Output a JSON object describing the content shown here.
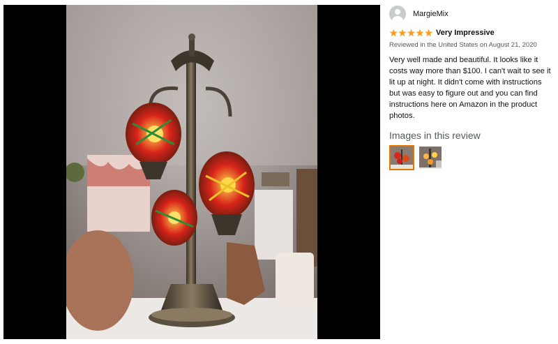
{
  "review": {
    "profile_name": "MargieMix",
    "rating": 5,
    "rating_max": 5,
    "title": "Very Impressive",
    "meta": "Reviewed in the United States on August 21, 2020",
    "body": "Very well made and beautiful. It looks like it costs way more than $100. I can't wait to see it lit up at night. It didn't come with instructions but was easy to figure out and you can find instructions here on Amazon in the product photos.",
    "images_heading": "Images in this review"
  },
  "colors": {
    "star": "#f7a01d",
    "selected_thumb_border": "#e77600",
    "meta_text": "#565959"
  },
  "icons": {
    "avatar": "person-silhouette-icon",
    "star": "star-icon"
  }
}
